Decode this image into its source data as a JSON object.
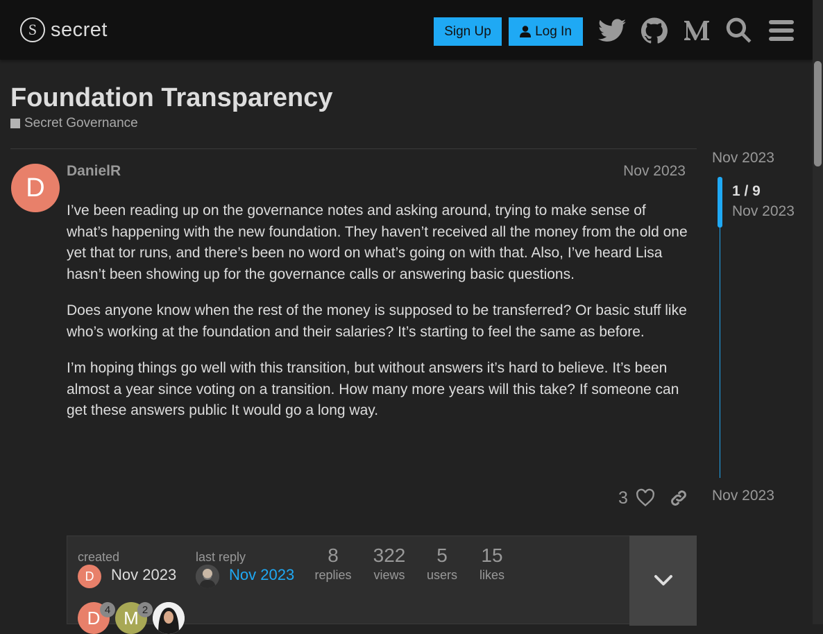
{
  "header": {
    "logo_glyph": "S",
    "logo_text": "secret",
    "signup_label": "Sign Up",
    "login_label": "Log In",
    "icons": [
      "twitter-icon",
      "github-icon",
      "medium-icon",
      "search-icon",
      "hamburger-menu-icon"
    ]
  },
  "topic": {
    "title": "Foundation Transparency",
    "category": "Secret Governance"
  },
  "post": {
    "avatar_letter": "D",
    "username": "DanielR",
    "date": "Nov 2023",
    "paragraphs": [
      "I’ve been reading up on the governance notes and asking around, trying to make sense of what’s happening with the new foundation. They haven’t received all the money from the old one yet that tor runs, and there’s been no word on what’s going on with that. Also, I’ve heard Lisa hasn’t been showing up for the governance calls or answering basic questions.",
      "Does anyone know when the rest of the money is supposed to be transferred? Or basic stuff like who’s working at the foundation and their salaries? It’s starting to feel the same as before.",
      "I’m hoping things go well with this transition, but without answers it’s hard to believe. It’s been almost a year since voting on a transition. How many more years will this take? If someone can get these answers public It would go a long way."
    ],
    "like_count": "3"
  },
  "topic_map": {
    "created_label": "created",
    "created_date": "Nov 2023",
    "created_avatar_letter": "D",
    "last_reply_label": "last reply",
    "last_reply_date": "Nov 2023",
    "stats": [
      {
        "num": "8",
        "label": "replies"
      },
      {
        "num": "322",
        "label": "views"
      },
      {
        "num": "5",
        "label": "users"
      },
      {
        "num": "15",
        "label": "likes"
      }
    ],
    "participants": [
      {
        "letter": "D",
        "count": "4",
        "color": "#e8806a"
      },
      {
        "letter": "M",
        "count": "2",
        "color": "#a8a855"
      },
      {
        "letter": "",
        "count": "",
        "color": "#eeeeee"
      }
    ]
  },
  "timeline": {
    "date_top": "Nov 2023",
    "counter": "1 / 9",
    "counter_date": "Nov 2023",
    "date_bottom": "Nov 2023"
  },
  "colors": {
    "accent": "#1fa9f4",
    "background": "#222222",
    "header": "#111111"
  }
}
